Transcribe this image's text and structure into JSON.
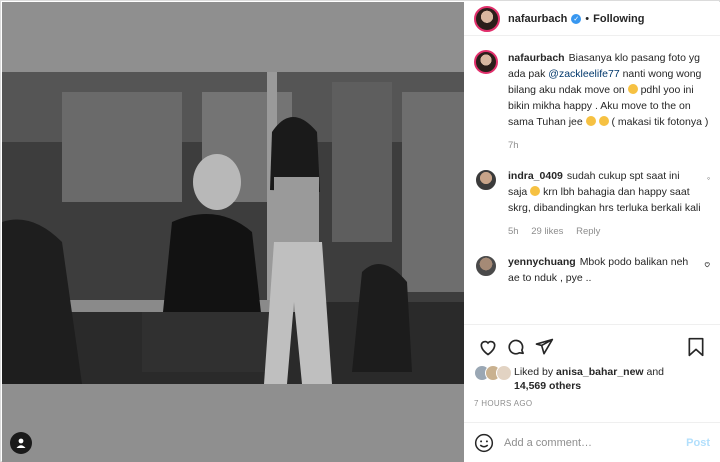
{
  "post": {
    "author": "nafaurbach",
    "follow_status": "Following",
    "caption_parts": {
      "before_mention": "Biasanya klo pasang foto yg ada pak ",
      "mention": "@zackleelife77",
      "after_mention": " nanti wong wong bilang aku ndak move on ",
      "after_emoji": " pdhl yoo ini bikin mikha happy . Aku move to the on sama Tuhan jee ",
      "tail": " ( makasi tik fotonya )"
    },
    "caption_time": "7h"
  },
  "comments": [
    {
      "username": "indra_0409",
      "text_before_emoji": "sudah cukup spt saat ini saja ",
      "text_after_emoji": " krn lbh bahagia dan happy saat skrg, dibandingkan hrs terluka berkali kali",
      "time": "5h",
      "likes": "29 likes",
      "reply_label": "Reply"
    },
    {
      "username": "yennychuang",
      "text": "Mbok podo balikan neh ae to nduk , pye .."
    }
  ],
  "likes": {
    "prefix": "Liked by ",
    "user": "anisa_bahar_new",
    "and": " and",
    "others": "14,569 others"
  },
  "time_ago": "7 HOURS AGO",
  "comment_box": {
    "placeholder": "Add a comment…",
    "post_label": "Post"
  },
  "icons": {
    "tag": "user-tag-icon",
    "verified": "verified-badge-icon",
    "like": "heart-icon",
    "comment": "comment-icon",
    "share": "share-icon",
    "save": "bookmark-icon",
    "emoji": "smiley-icon",
    "more": "more-options-icon"
  },
  "colors": {
    "accent_blue": "#3897f0",
    "link_blue": "#00376b",
    "muted": "#8e8e8e",
    "post_disabled": "#b2dffc"
  }
}
